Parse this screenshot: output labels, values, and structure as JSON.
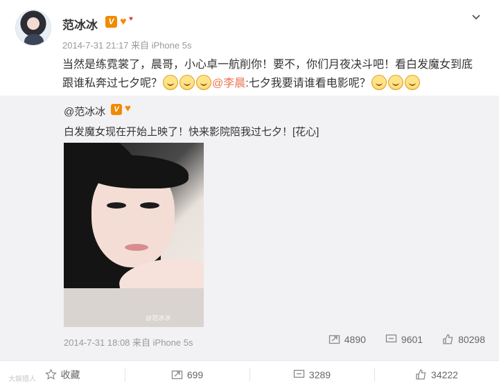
{
  "author": {
    "name": "范冰冰",
    "meta": "2014-7-31 21:17 来自 iPhone 5s"
  },
  "post": {
    "text_before": "当然是练霓裳了，晨哥，小心卓一航削你！要不，你们月夜决斗吧！看白发魔女到底跟谁私奔过七夕呢？",
    "mention": "@李晨",
    "text_after": ":七夕我要请谁看电影呢？"
  },
  "repost": {
    "user": "@范冰冰",
    "text": "白发魔女现在开始上映了！快来影院陪我过七夕！[花心]",
    "meta": "2014-7-31 18:08 来自 iPhone 5s",
    "stats": {
      "reposts": "4890",
      "comments": "9601",
      "likes": "80298"
    },
    "image_watermark": "@范冰冰"
  },
  "actions": {
    "favorite": "收藏",
    "repost": "699",
    "comment": "3289",
    "like": "34222"
  },
  "watermark": "大娱猎人",
  "colors": {
    "mention": "#eb7350",
    "badge": "#f08a00",
    "repost_bg": "#f2f2f5"
  },
  "icons": [
    "chevron-down-icon",
    "verified-v-icon",
    "vip-heart-icon",
    "repost-icon",
    "comment-icon",
    "like-icon",
    "star-icon"
  ]
}
